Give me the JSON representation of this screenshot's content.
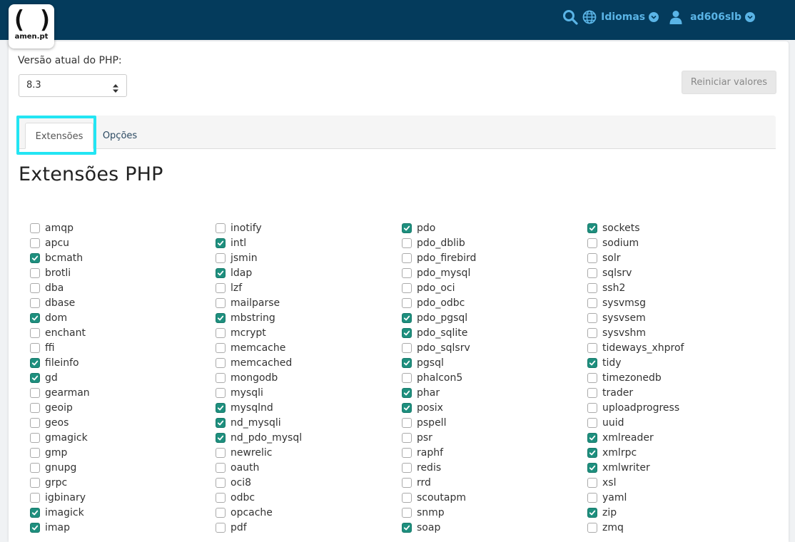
{
  "header": {
    "logo_text": "amen.pt",
    "languages_label": "Idiomas",
    "username": "ad606slb",
    "icons": {
      "search": "search-icon",
      "globe": "globe-icon",
      "user": "user-icon",
      "caret": "chevron-down-icon"
    },
    "colors": {
      "bar": "#043b5c",
      "accent": "#5ab4e6"
    }
  },
  "php": {
    "version_label": "Versão atual do PHP:",
    "selected_version": "8.3",
    "reset_label": "Reiniciar valores"
  },
  "tabs": {
    "extensions": "Extensões",
    "options": "Opções",
    "active": "extensions",
    "highlight_color": "#23e5f3"
  },
  "section_title": "Extensões PHP",
  "checkbox_checked_color": "#1e8f7e",
  "extension_columns": [
    [
      {
        "name": "amqp",
        "checked": false
      },
      {
        "name": "apcu",
        "checked": false
      },
      {
        "name": "bcmath",
        "checked": true
      },
      {
        "name": "brotli",
        "checked": false
      },
      {
        "name": "dba",
        "checked": false
      },
      {
        "name": "dbase",
        "checked": false
      },
      {
        "name": "dom",
        "checked": true
      },
      {
        "name": "enchant",
        "checked": false
      },
      {
        "name": "ffi",
        "checked": false
      },
      {
        "name": "fileinfo",
        "checked": true
      },
      {
        "name": "gd",
        "checked": true
      },
      {
        "name": "gearman",
        "checked": false
      },
      {
        "name": "geoip",
        "checked": false
      },
      {
        "name": "geos",
        "checked": false
      },
      {
        "name": "gmagick",
        "checked": false
      },
      {
        "name": "gmp",
        "checked": false
      },
      {
        "name": "gnupg",
        "checked": false
      },
      {
        "name": "grpc",
        "checked": false
      },
      {
        "name": "igbinary",
        "checked": false
      },
      {
        "name": "imagick",
        "checked": true
      },
      {
        "name": "imap",
        "checked": true
      }
    ],
    [
      {
        "name": "inotify",
        "checked": false
      },
      {
        "name": "intl",
        "checked": true
      },
      {
        "name": "jsmin",
        "checked": false
      },
      {
        "name": "ldap",
        "checked": true
      },
      {
        "name": "lzf",
        "checked": false
      },
      {
        "name": "mailparse",
        "checked": false
      },
      {
        "name": "mbstring",
        "checked": true
      },
      {
        "name": "mcrypt",
        "checked": false
      },
      {
        "name": "memcache",
        "checked": false
      },
      {
        "name": "memcached",
        "checked": false
      },
      {
        "name": "mongodb",
        "checked": false
      },
      {
        "name": "mysqli",
        "checked": false
      },
      {
        "name": "mysqlnd",
        "checked": true
      },
      {
        "name": "nd_mysqli",
        "checked": true
      },
      {
        "name": "nd_pdo_mysql",
        "checked": true
      },
      {
        "name": "newrelic",
        "checked": false
      },
      {
        "name": "oauth",
        "checked": false
      },
      {
        "name": "oci8",
        "checked": false
      },
      {
        "name": "odbc",
        "checked": false
      },
      {
        "name": "opcache",
        "checked": false
      },
      {
        "name": "pdf",
        "checked": false
      }
    ],
    [
      {
        "name": "pdo",
        "checked": true
      },
      {
        "name": "pdo_dblib",
        "checked": false
      },
      {
        "name": "pdo_firebird",
        "checked": false
      },
      {
        "name": "pdo_mysql",
        "checked": false
      },
      {
        "name": "pdo_oci",
        "checked": false
      },
      {
        "name": "pdo_odbc",
        "checked": false
      },
      {
        "name": "pdo_pgsql",
        "checked": true
      },
      {
        "name": "pdo_sqlite",
        "checked": true
      },
      {
        "name": "pdo_sqlsrv",
        "checked": false
      },
      {
        "name": "pgsql",
        "checked": true
      },
      {
        "name": "phalcon5",
        "checked": false
      },
      {
        "name": "phar",
        "checked": true
      },
      {
        "name": "posix",
        "checked": true
      },
      {
        "name": "pspell",
        "checked": false
      },
      {
        "name": "psr",
        "checked": false
      },
      {
        "name": "raphf",
        "checked": false
      },
      {
        "name": "redis",
        "checked": false
      },
      {
        "name": "rrd",
        "checked": false
      },
      {
        "name": "scoutapm",
        "checked": false
      },
      {
        "name": "snmp",
        "checked": false
      },
      {
        "name": "soap",
        "checked": true
      }
    ],
    [
      {
        "name": "sockets",
        "checked": true
      },
      {
        "name": "sodium",
        "checked": false
      },
      {
        "name": "solr",
        "checked": false
      },
      {
        "name": "sqlsrv",
        "checked": false
      },
      {
        "name": "ssh2",
        "checked": false
      },
      {
        "name": "sysvmsg",
        "checked": false
      },
      {
        "name": "sysvsem",
        "checked": false
      },
      {
        "name": "sysvshm",
        "checked": false
      },
      {
        "name": "tideways_xhprof",
        "checked": false
      },
      {
        "name": "tidy",
        "checked": true
      },
      {
        "name": "timezonedb",
        "checked": false
      },
      {
        "name": "trader",
        "checked": false
      },
      {
        "name": "uploadprogress",
        "checked": false
      },
      {
        "name": "uuid",
        "checked": false
      },
      {
        "name": "xmlreader",
        "checked": true
      },
      {
        "name": "xmlrpc",
        "checked": true
      },
      {
        "name": "xmlwriter",
        "checked": true
      },
      {
        "name": "xsl",
        "checked": false
      },
      {
        "name": "yaml",
        "checked": false
      },
      {
        "name": "zip",
        "checked": true
      },
      {
        "name": "zmq",
        "checked": false
      }
    ]
  ]
}
